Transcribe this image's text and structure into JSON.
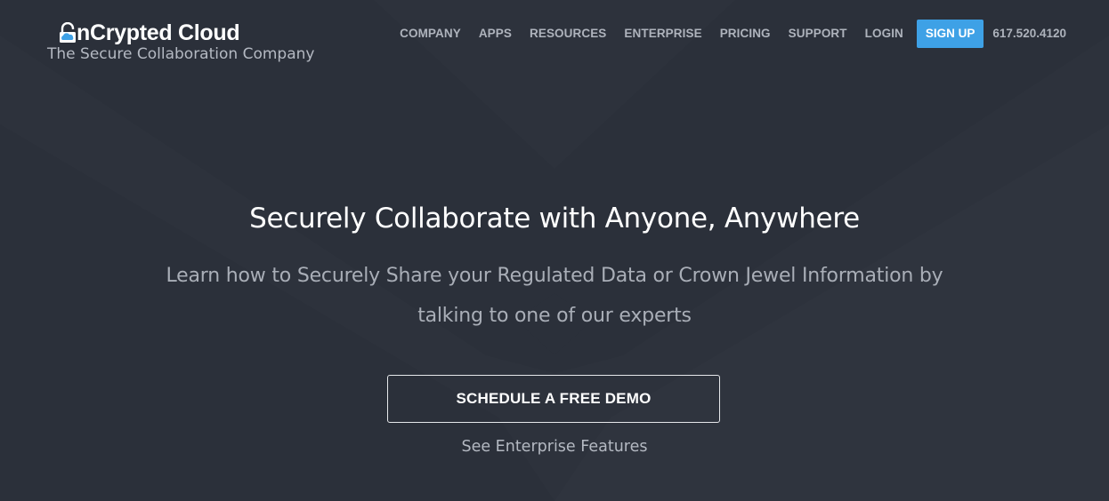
{
  "brand": {
    "name": "nCrypted Cloud",
    "tagline": "The Secure Collaboration Company"
  },
  "nav": {
    "items": [
      "COMPANY",
      "APPS",
      "RESOURCES",
      "ENTERPRISE",
      "PRICING",
      "SUPPORT",
      "LOGIN"
    ],
    "signup_label": "SIGN UP",
    "phone": "617.520.4120"
  },
  "hero": {
    "title": "Securely Collaborate with Anyone, Anywhere",
    "subtitle": "Learn how to Securely Share your Regulated Data or Crown Jewel Information by talking to one of our experts",
    "cta_label": "SCHEDULE A FREE DEMO",
    "secondary_link": "See Enterprise Features"
  },
  "colors": {
    "background": "#2d323c",
    "accent": "#3ea1e6",
    "text_primary": "#ffffff",
    "text_muted": "#aeb3bc"
  }
}
